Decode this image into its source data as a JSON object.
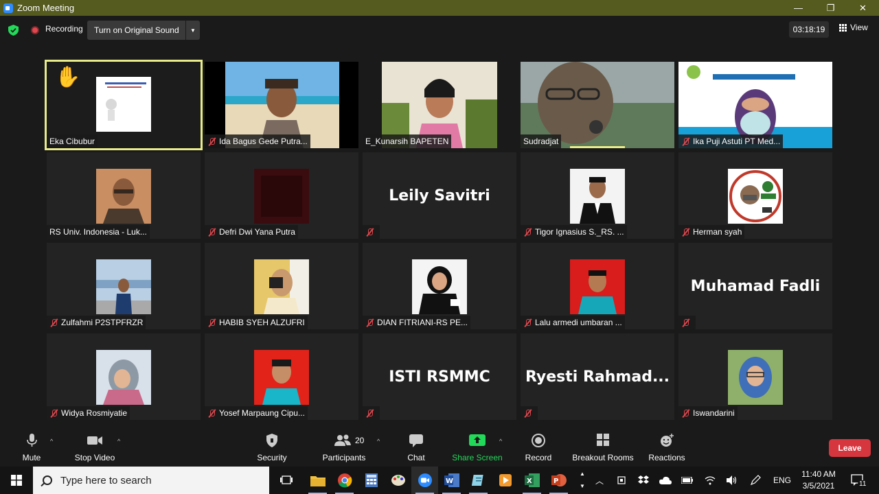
{
  "titlebar": {
    "title": "Zoom Meeting",
    "minimize": "—",
    "maximize": "❐",
    "close": "✕"
  },
  "infobar": {
    "recording": "Recording",
    "original_sound": "Turn on Original Sound",
    "timer": "03:18:19",
    "view": "View"
  },
  "participants": [
    {
      "name": "Eka Cibubur",
      "muted": false,
      "kind": "video",
      "active": true
    },
    {
      "name": "Ida Bagus Gede Putra...",
      "muted": true,
      "kind": "video"
    },
    {
      "name": "E_Kunarsih BAPETEN",
      "muted": false,
      "kind": "video"
    },
    {
      "name": "Sudradjat",
      "muted": false,
      "kind": "video"
    },
    {
      "name": "Ika Puji Astuti PT Med...",
      "muted": true,
      "kind": "video"
    },
    {
      "name": "RS Univ. Indonesia - Luk...",
      "muted": false,
      "kind": "photo"
    },
    {
      "name": "Defri Dwi Yana Putra",
      "muted": true,
      "kind": "photo"
    },
    {
      "name": "",
      "display": "Leily Savitri",
      "muted": true,
      "kind": "text"
    },
    {
      "name": "Tigor Ignasius S._RS. ...",
      "muted": true,
      "kind": "photo"
    },
    {
      "name": "Herman syah",
      "muted": true,
      "kind": "photo"
    },
    {
      "name": "Zulfahmi P2STPFRZR",
      "muted": true,
      "kind": "photo"
    },
    {
      "name": "HABIB SYEH ALZUFRI",
      "muted": true,
      "kind": "photo"
    },
    {
      "name": "DIAN FITRIANI-RS PE...",
      "muted": true,
      "kind": "photo"
    },
    {
      "name": "Lalu armedi umbaran ...",
      "muted": true,
      "kind": "photo"
    },
    {
      "name": "",
      "display": "Muhamad Fadli",
      "muted": true,
      "kind": "text"
    },
    {
      "name": "Widya Rosmiyatie",
      "muted": true,
      "kind": "photo"
    },
    {
      "name": "Yosef Marpaung Cipu...",
      "muted": true,
      "kind": "photo"
    },
    {
      "name": "",
      "display": "ISTI RSMMC",
      "muted": true,
      "kind": "text"
    },
    {
      "name": "",
      "display": "Ryesti  Rahmad...",
      "muted": true,
      "kind": "text"
    },
    {
      "name": "Iswandarini",
      "muted": true,
      "kind": "photo"
    }
  ],
  "toolbar": {
    "mute": "Mute",
    "stop_video": "Stop Video",
    "security": "Security",
    "participants": "Participants",
    "participants_count": "20",
    "chat": "Chat",
    "share_screen": "Share Screen",
    "record": "Record",
    "breakout_rooms": "Breakout Rooms",
    "reactions": "Reactions",
    "leave": "Leave"
  },
  "taskbar": {
    "search_placeholder": "Type here to search",
    "lang": "ENG",
    "time": "11:40 AM",
    "date": "3/5/2021",
    "notifications": "11"
  },
  "colors": {
    "accent_green": "#23d959",
    "leave_red": "#d6363e",
    "active_border": "#e8ec8a",
    "titlebar": "#555a1f"
  }
}
